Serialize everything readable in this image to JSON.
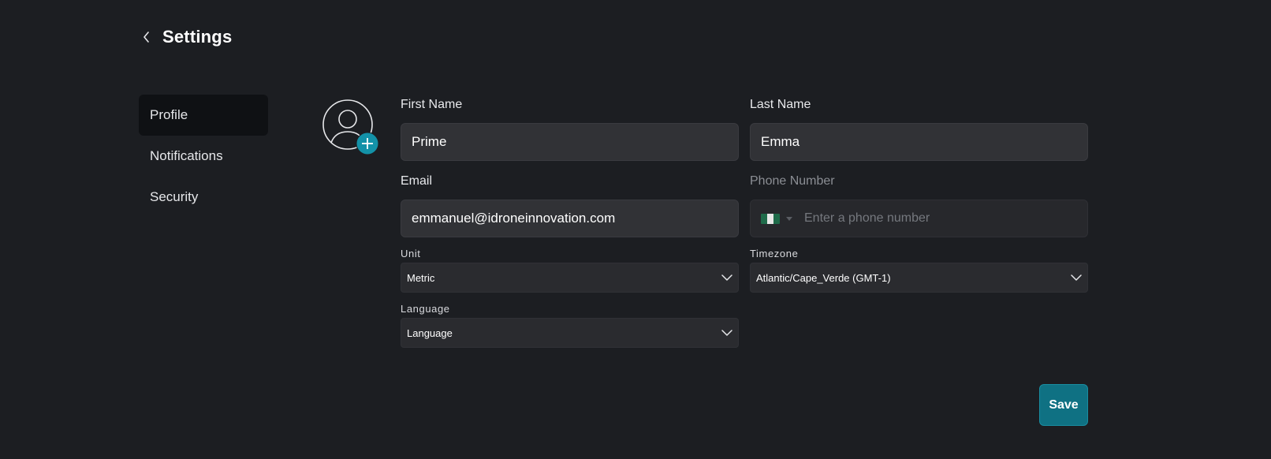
{
  "header": {
    "title": "Settings"
  },
  "sidebar": {
    "items": [
      {
        "label": "Profile"
      },
      {
        "label": "Notifications"
      },
      {
        "label": "Security"
      }
    ]
  },
  "form": {
    "first_name": {
      "label": "First Name",
      "value": "Prime"
    },
    "last_name": {
      "label": "Last Name",
      "value": "Emma"
    },
    "email": {
      "label": "Email",
      "value": "emmanuel@idroneinnovation.com"
    },
    "phone": {
      "label": "Phone Number",
      "placeholder": "Enter a phone number",
      "country_flag": "nigeria-flag",
      "value": ""
    },
    "unit": {
      "label": "Unit",
      "value": "Metric"
    },
    "timezone": {
      "label": "Timezone",
      "value": "Atlantic/Cape_Verde (GMT-1)"
    },
    "language": {
      "label": "Language",
      "value": "Language"
    }
  },
  "actions": {
    "save_label": "Save"
  },
  "colors": {
    "background": "#1c1e22",
    "accent": "#0f7183",
    "avatar_badge": "#1392a8",
    "active_nav": "#0f1114",
    "flag_green": "#1f6b4a",
    "flag_white": "#e8e8e8"
  },
  "icons": {
    "back": "chevron-left-icon",
    "avatar": "user-circle-icon",
    "add_photo": "plus-icon",
    "dropdown": "chevron-down-icon"
  }
}
